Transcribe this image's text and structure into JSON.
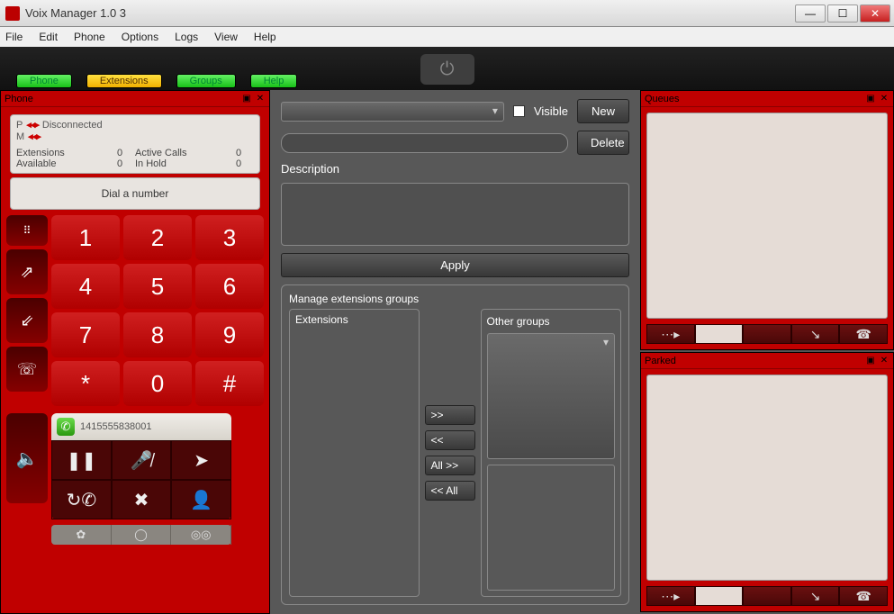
{
  "window": {
    "title": "Voix Manager 1.0 3"
  },
  "menu": {
    "file": "File",
    "edit": "Edit",
    "phone": "Phone",
    "options": "Options",
    "logs": "Logs",
    "view": "View",
    "help": "Help"
  },
  "tabs": {
    "phone": "Phone",
    "extensions": "Extensions",
    "groups": "Groups",
    "help": "Help"
  },
  "phone_panel": {
    "title": "Phone",
    "p_label": "P",
    "m_label": "M",
    "status": "Disconnected",
    "extensions_label": "Extensions",
    "extensions_val": "0",
    "available_label": "Available",
    "available_val": "0",
    "active_label": "Active Calls",
    "active_val": "0",
    "hold_label": "In Hold",
    "hold_val": "0",
    "dial_label": "Dial a number",
    "keys": [
      "1",
      "2",
      "3",
      "4",
      "5",
      "6",
      "7",
      "8",
      "9",
      "*",
      "0",
      "#"
    ],
    "call_number": "1415555838001"
  },
  "center": {
    "visible_label": "Visible",
    "new_btn": "New",
    "delete_btn": "Delete",
    "description_label": "Description",
    "apply_btn": "Apply",
    "mgr_title": "Manage extensions groups",
    "extensions_hdr": "Extensions",
    "other_hdr": "Other groups",
    "move_r": ">>",
    "move_l": "<<",
    "move_all_r": "All >>",
    "move_all_l": "<< All"
  },
  "queues": {
    "title": "Queues"
  },
  "parked": {
    "title": "Parked"
  }
}
